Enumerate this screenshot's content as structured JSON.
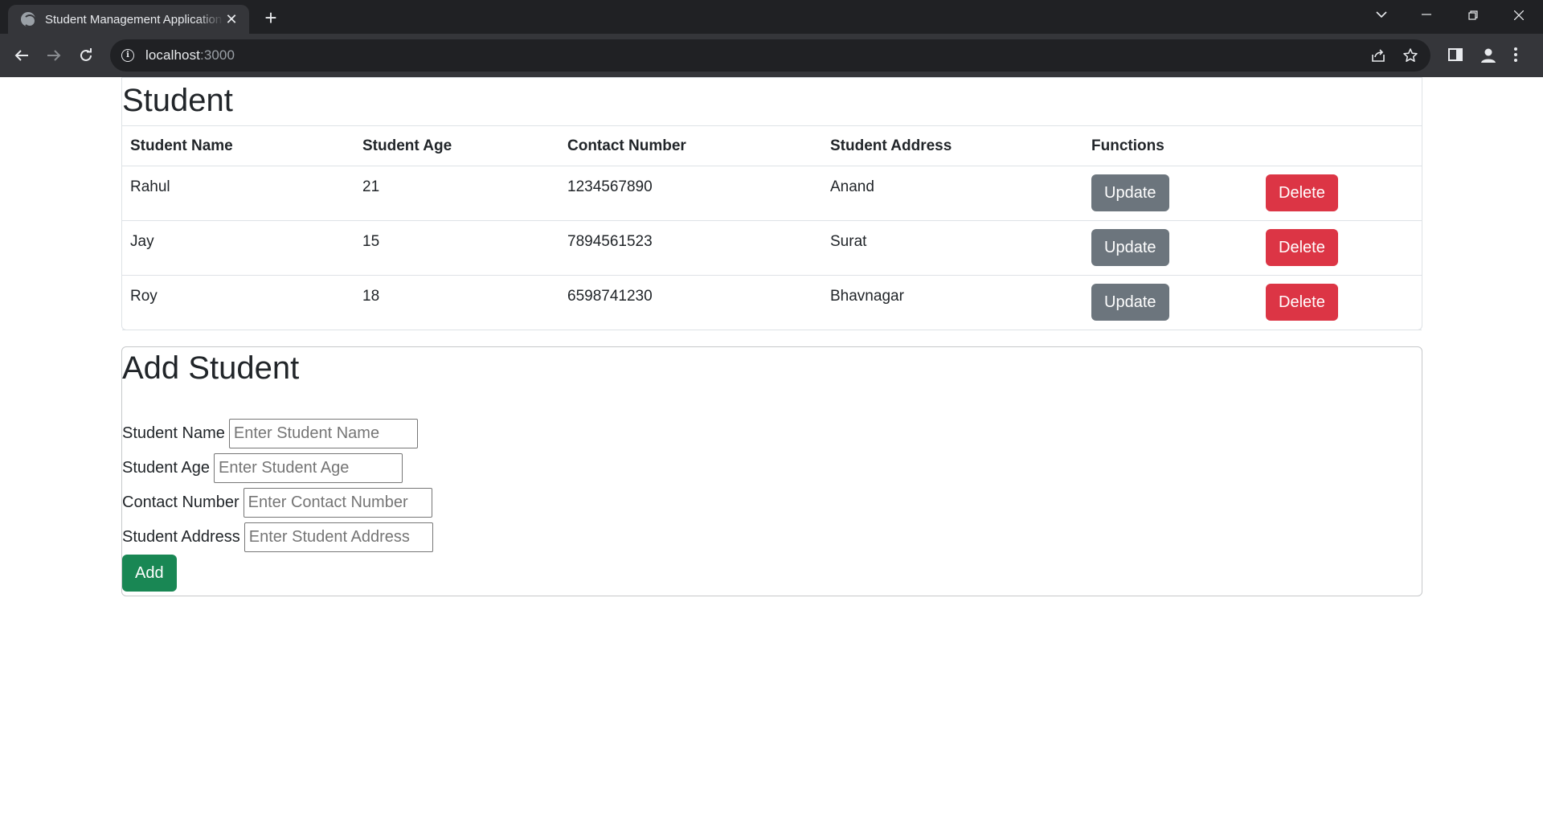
{
  "browser": {
    "tab_title": "Student Management Application",
    "tab_close": "✕",
    "new_tab": "+",
    "url_host": "localhost",
    "url_port": ":3000"
  },
  "page": {
    "title": "Student",
    "table": {
      "headers": [
        "Student Name",
        "Student Age",
        "Contact Number",
        "Student Address",
        "Functions"
      ],
      "rows": [
        {
          "name": "Rahul",
          "age": "21",
          "contact": "1234567890",
          "address": "Anand"
        },
        {
          "name": "Jay",
          "age": "15",
          "contact": "7894561523",
          "address": "Surat"
        },
        {
          "name": "Roy",
          "age": "18",
          "contact": "6598741230",
          "address": "Bhavnagar"
        }
      ],
      "update_label": "Update",
      "delete_label": "Delete"
    },
    "add_form": {
      "title": "Add Student",
      "name_label": "Student Name",
      "name_placeholder": "Enter Student Name",
      "age_label": "Student Age",
      "age_placeholder": "Enter Student Age",
      "contact_label": "Contact Number",
      "contact_placeholder": "Enter Contact Number",
      "address_label": "Student Address",
      "address_placeholder": "Enter Student Address",
      "submit_label": "Add"
    }
  },
  "colors": {
    "update": "#6c757d",
    "delete": "#dc3545",
    "add": "#198754"
  }
}
